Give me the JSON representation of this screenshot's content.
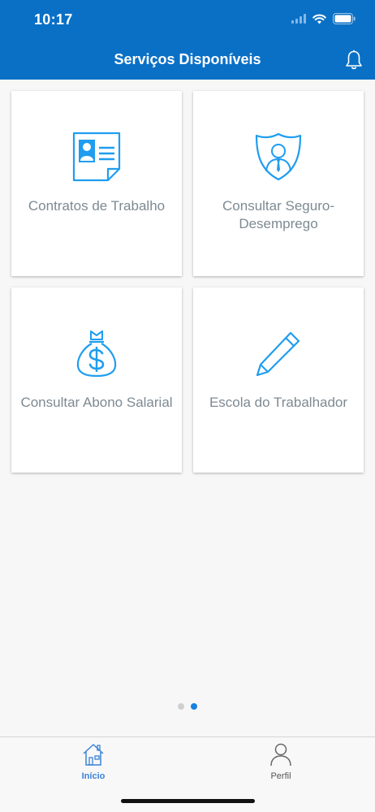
{
  "status_bar": {
    "time": "10:17"
  },
  "header": {
    "title": "Serviços Disponíveis",
    "notification_icon": "bell-icon"
  },
  "cards": [
    {
      "label": "Contratos de Trabalho",
      "icon": "contract-document-icon"
    },
    {
      "label": "Consultar Seguro-Desemprego",
      "icon": "shield-person-icon"
    },
    {
      "label": "Consultar Abono Salarial",
      "icon": "money-bag-icon"
    },
    {
      "label": "Escola do Trabalhador",
      "icon": "pencil-icon"
    }
  ],
  "pager": {
    "pages": 2,
    "active_page": 2
  },
  "tabbar": {
    "tabs": [
      {
        "label": "Início",
        "icon": "home-icon",
        "active": true
      },
      {
        "label": "Perfil",
        "icon": "person-icon",
        "active": false
      }
    ]
  },
  "colors": {
    "primary": "#0a70c6",
    "icon_blue": "#1f9df0",
    "label_gray": "#7d8a92",
    "active_tab": "#3a82d6"
  }
}
